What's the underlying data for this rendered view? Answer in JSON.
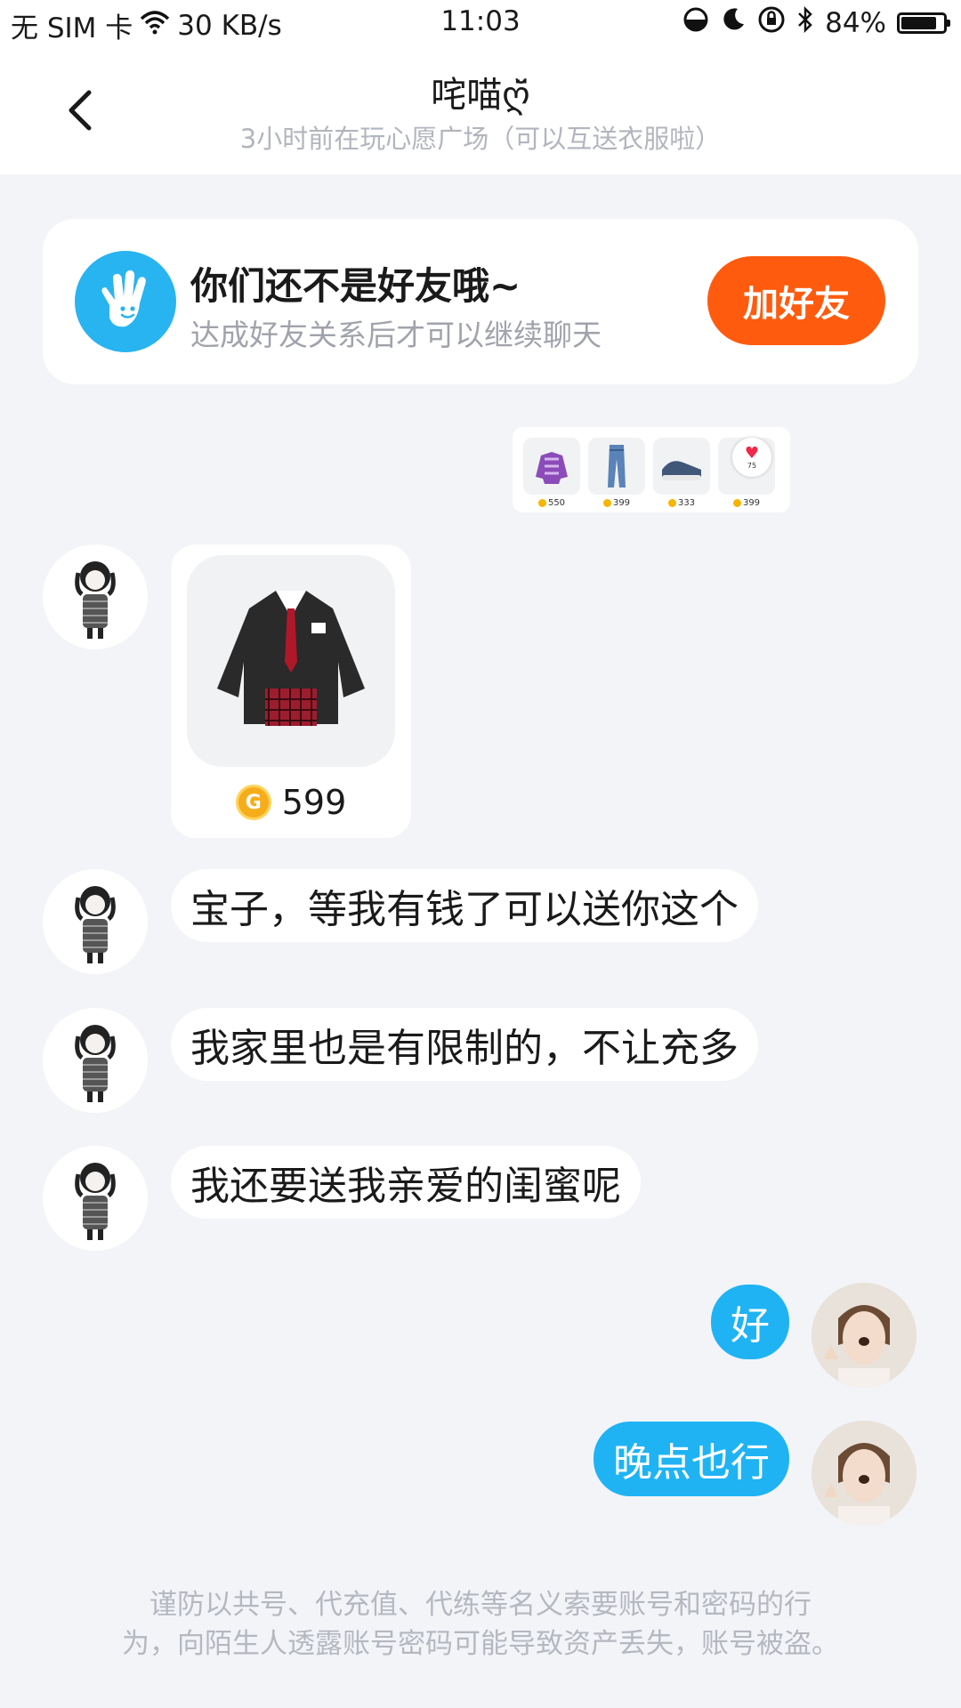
{
  "status_bar": {
    "sim": "无 SIM 卡",
    "speed": "30 KB/s",
    "time": "11:03",
    "battery_percent": "84%",
    "battery_level": 0.84,
    "icons": [
      "wifi-icon",
      "data-saver-icon",
      "moon-icon",
      "rotation-lock-icon",
      "bluetooth-icon",
      "battery-icon"
    ]
  },
  "header": {
    "title": "咤喵ღ̆̈",
    "subtitle": "3小时前在玩心愿广场（可以互送衣服啦）",
    "back_icon": "chevron-left-icon"
  },
  "friend_card": {
    "title": "你们还不是好友哦~",
    "subtitle": "达成好友关系后才可以继续聊天",
    "button": "加好友",
    "icon": "hand-icon",
    "button_color": "#ff5b0f",
    "icon_color": "#28b4f0"
  },
  "outfit_strip": {
    "items": [
      {
        "icon": "purple-jacket-icon",
        "price": "550"
      },
      {
        "icon": "jeans-icon",
        "price": "399"
      },
      {
        "icon": "sneakers-icon",
        "price": "333"
      },
      {
        "icon": "heart-item-icon",
        "price": "399",
        "likes": "75"
      }
    ]
  },
  "gift_card": {
    "item_icon": "blazer-uniform-icon",
    "price": "599",
    "coin_icon": "coin-icon"
  },
  "messages": [
    {
      "from": "other",
      "text": "宝子，等我有钱了可以送你这个"
    },
    {
      "from": "other",
      "text": "我家里也是有限制的，不让充多"
    },
    {
      "from": "other",
      "text": "我还要送我亲爱的闺蜜呢"
    },
    {
      "from": "me",
      "text": "好"
    },
    {
      "from": "me",
      "text": "晚点也行"
    }
  ],
  "warning": {
    "line1": "谨防以共号、代充值、代练等名义索要账号和密码的行",
    "line2": "为，向陌生人透露账号密码可能导致资产丢失，账号被盗。"
  },
  "colors": {
    "outgoing_bubble": "#1fb3f4",
    "background": "#f3f4f8"
  }
}
